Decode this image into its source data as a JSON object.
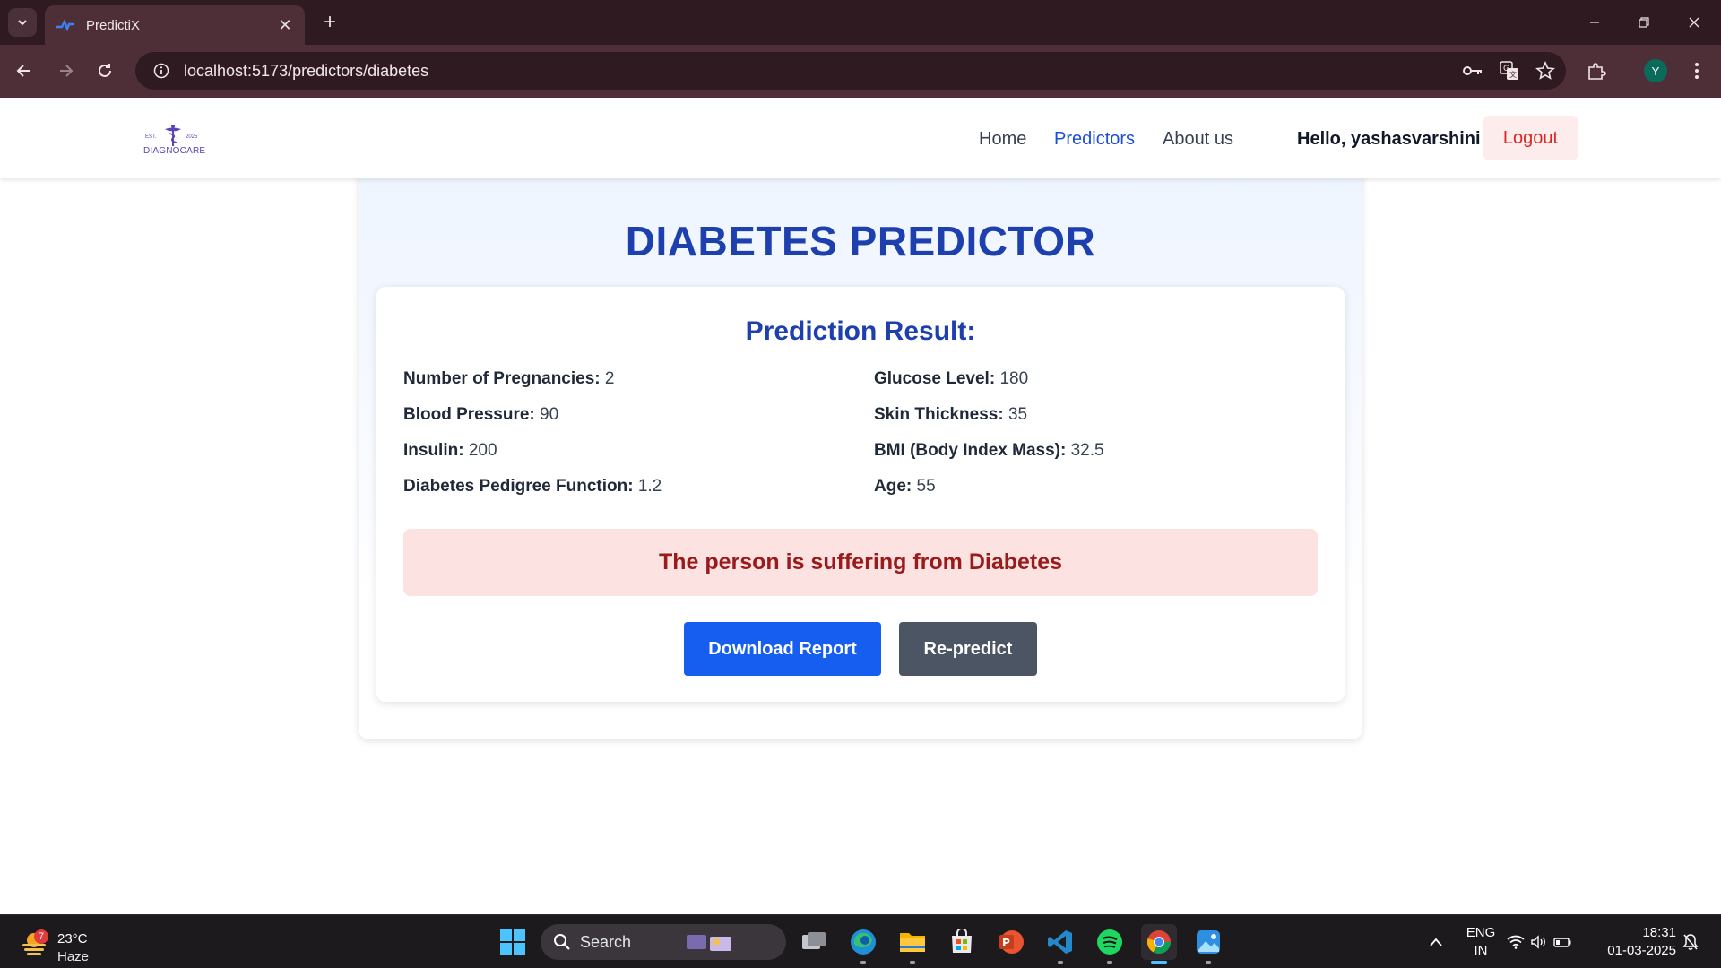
{
  "browser": {
    "tab_title": "PredictiX",
    "url": "localhost:5173/predictors/diabetes",
    "profile_initial": "Y"
  },
  "header": {
    "logo": {
      "est": "EST.",
      "year": "2025",
      "name": "DIAGNOCARE"
    },
    "nav": [
      "Home",
      "Predictors",
      "About us"
    ],
    "active_nav": "Predictors",
    "greeting": "Hello, yashasvarshini",
    "logout_label": "Logout"
  },
  "main": {
    "title": "DIABETES PREDICTOR",
    "result_title": "Prediction Result:",
    "fields": [
      {
        "label": "Number of Pregnancies:",
        "value": "2"
      },
      {
        "label": "Glucose Level:",
        "value": "180"
      },
      {
        "label": "Blood Pressure:",
        "value": "90"
      },
      {
        "label": "Skin Thickness:",
        "value": "35"
      },
      {
        "label": "Insulin:",
        "value": "200"
      },
      {
        "label": "BMI (Body Index Mass):",
        "value": "32.5"
      },
      {
        "label": "Diabetes Pedigree Function:",
        "value": "1.2"
      },
      {
        "label": "Age:",
        "value": "55"
      }
    ],
    "verdict": "The person is suffering from Diabetes",
    "download_label": "Download Report",
    "repredict_label": "Re-predict"
  },
  "taskbar": {
    "weather_temp": "23°C",
    "weather_desc": "Haze",
    "weather_badge": "7",
    "search_label": "Search",
    "lang_top": "ENG",
    "lang_bottom": "IN",
    "time": "18:31",
    "date": "01-03-2025"
  },
  "colors": {
    "accent": "#1e40af",
    "button_primary": "#155eef",
    "button_secondary": "#4b5563",
    "danger_bg": "#fde2e2",
    "danger_text": "#991b1b"
  }
}
